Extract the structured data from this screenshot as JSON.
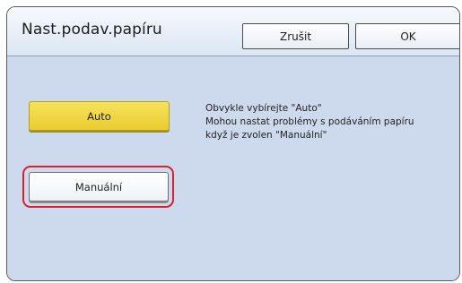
{
  "header": {
    "title": "Nast.podav.papíru",
    "cancel_label": "Zrušit",
    "ok_label": "OK"
  },
  "options": {
    "auto_label": "Auto",
    "manual_label": "Manuální",
    "highlighted": "Manuální"
  },
  "info_lines": [
    "Obvykle vybírejte \"Auto\"",
    "Mohou nastat problémy s podáváním papíru",
    "když je zvolen \"Manuální\""
  ],
  "colors": {
    "header_bg": "#dbe6f3",
    "body_bg": "#cdd9ec",
    "auto_button": "#f0d644",
    "highlight_ring": "#d8202e"
  }
}
